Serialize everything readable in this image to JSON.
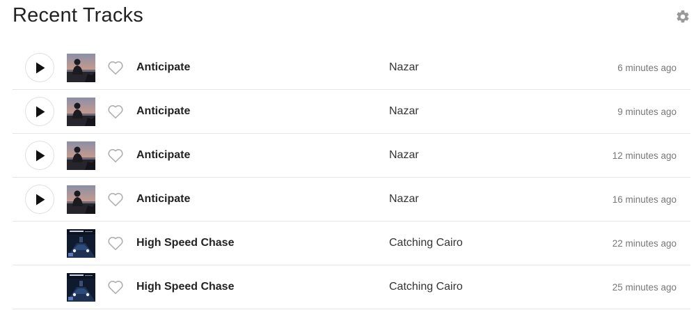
{
  "header": {
    "title": "Recent Tracks",
    "settings_icon": "gear-icon"
  },
  "tracks": [
    {
      "name": "Anticipate",
      "artist": "Nazar",
      "time": "6 minutes ago",
      "playable": true,
      "cover": "anticipate"
    },
    {
      "name": "Anticipate",
      "artist": "Nazar",
      "time": "9 minutes ago",
      "playable": true,
      "cover": "anticipate"
    },
    {
      "name": "Anticipate",
      "artist": "Nazar",
      "time": "12 minutes ago",
      "playable": true,
      "cover": "anticipate"
    },
    {
      "name": "Anticipate",
      "artist": "Nazar",
      "time": "16 minutes ago",
      "playable": true,
      "cover": "anticipate"
    },
    {
      "name": "High Speed Chase",
      "artist": "Catching Cairo",
      "time": "22 minutes ago",
      "playable": false,
      "cover": "high-speed-chase"
    },
    {
      "name": "High Speed Chase",
      "artist": "Catching Cairo",
      "time": "25 minutes ago",
      "playable": false,
      "cover": "high-speed-chase"
    }
  ],
  "colors": {
    "text": "#222222",
    "muted": "#777777",
    "icon": "#999999",
    "divider": "#e6e6e6"
  }
}
